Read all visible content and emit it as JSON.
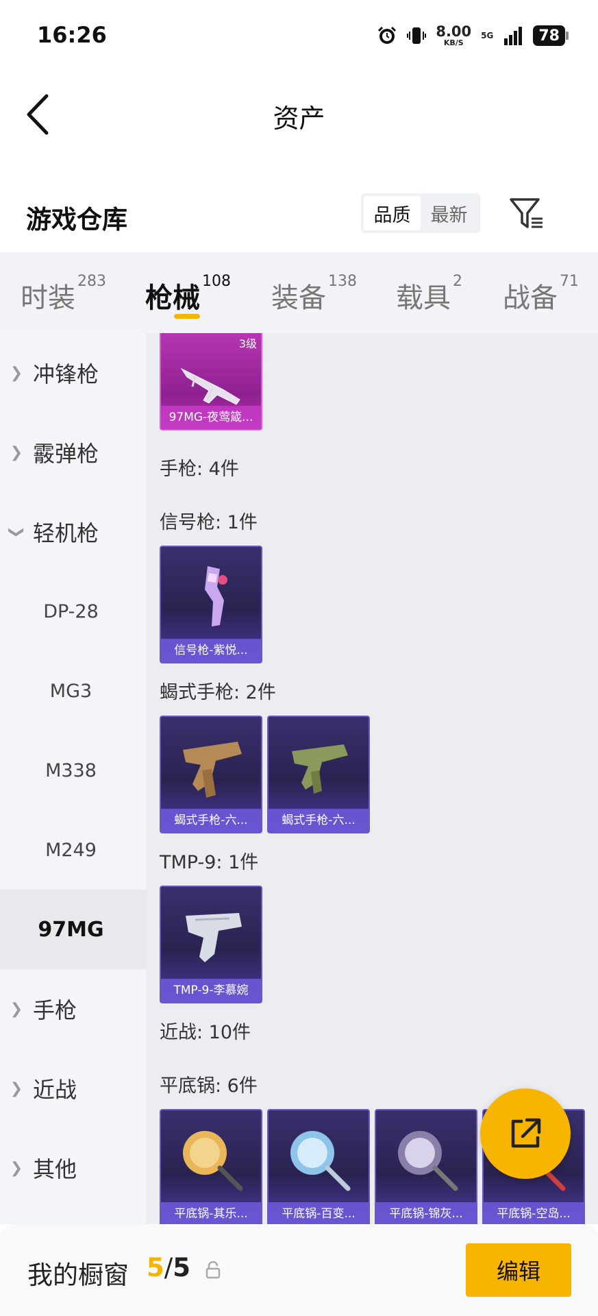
{
  "status_bar": {
    "time": "16:26",
    "speed_value": "8.00",
    "speed_unit": "KB/S",
    "network": "5G",
    "battery": "78"
  },
  "header": {
    "title": "资产"
  },
  "warehouse": {
    "title": "游戏仓库",
    "sort_options": [
      "品质",
      "最新"
    ],
    "active_sort": "品质"
  },
  "tabs": [
    {
      "label": "时装",
      "count": "283"
    },
    {
      "label": "枪械",
      "count": "108"
    },
    {
      "label": "装备",
      "count": "138"
    },
    {
      "label": "载具",
      "count": "2"
    },
    {
      "label": "战备",
      "count": "71"
    }
  ],
  "active_tab": "枪械",
  "sidebar": {
    "items": [
      {
        "label": "冲锋枪",
        "type": "group",
        "expanded": false
      },
      {
        "label": "霰弹枪",
        "type": "group",
        "expanded": false
      },
      {
        "label": "轻机枪",
        "type": "group",
        "expanded": true
      },
      {
        "label": "DP-28",
        "type": "sub"
      },
      {
        "label": "MG3",
        "type": "sub"
      },
      {
        "label": "M338",
        "type": "sub"
      },
      {
        "label": "M249",
        "type": "sub"
      },
      {
        "label": "97MG",
        "type": "sub",
        "selected": true
      },
      {
        "label": "手枪",
        "type": "group",
        "expanded": false
      },
      {
        "label": "近战",
        "type": "group",
        "expanded": false
      },
      {
        "label": "其他",
        "type": "group",
        "expanded": false
      }
    ]
  },
  "content": {
    "top_card": {
      "caption": "97MG-夜莺箴...",
      "level": "3级"
    },
    "sections": [
      {
        "label": "手枪: 4件"
      },
      {
        "label": "信号枪: 1件",
        "cards": [
          "信号枪-紫悦..."
        ]
      },
      {
        "label": "蝎式手枪: 2件",
        "cards": [
          "蝎式手枪-六...",
          "蝎式手枪-六..."
        ]
      },
      {
        "label": "TMP-9: 1件",
        "cards": [
          "TMP-9-李慕婉"
        ]
      },
      {
        "label": "近战: 10件"
      },
      {
        "label": "平底锅: 6件",
        "cards": [
          "平底锅-其乐...",
          "平底锅-百变...",
          "平底锅-锦灰...",
          "平底锅-空岛..."
        ]
      }
    ]
  },
  "bottom_bar": {
    "label": "我的橱窗",
    "current": "5",
    "separator": "/",
    "total": "5",
    "edit_label": "编辑"
  },
  "colors": {
    "accent": "#f7b500",
    "card_purple": "#3a2f6e",
    "card_pink": "#c23bbd"
  }
}
